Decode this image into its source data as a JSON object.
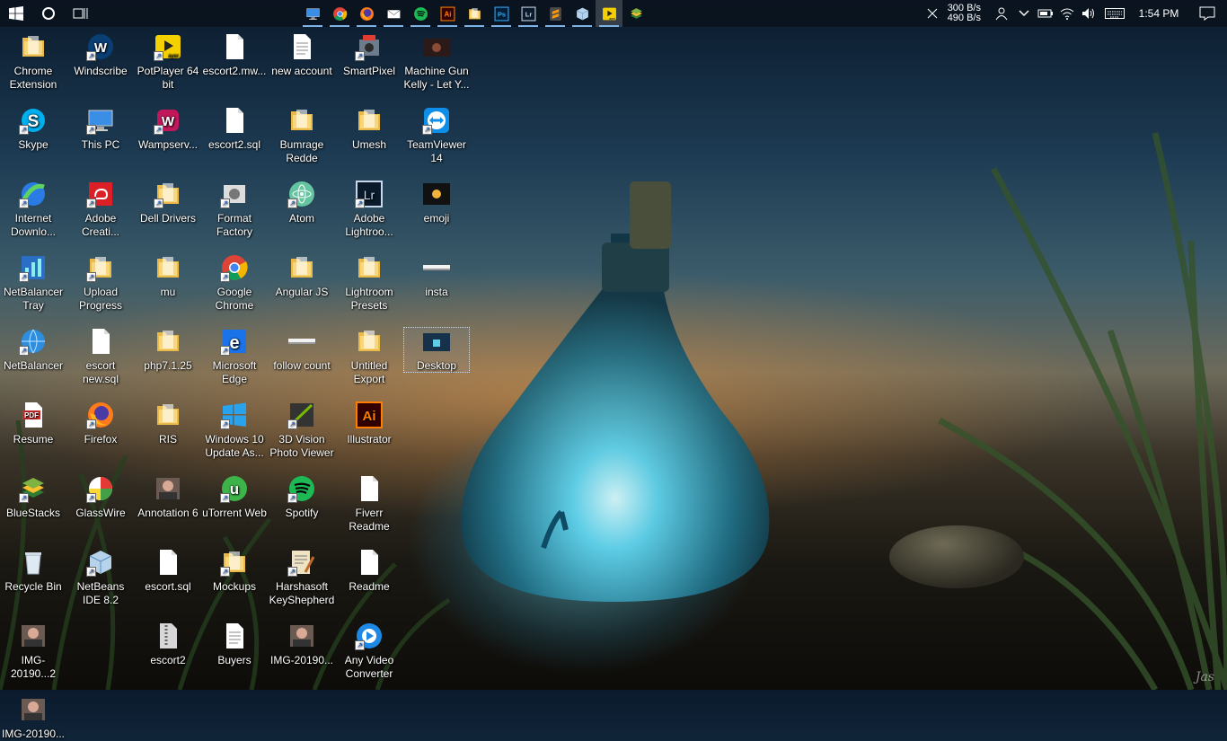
{
  "taskbar": {
    "network_up": "300 B/s",
    "network_down": "490 B/s",
    "clock": "1:54 PM",
    "apps": [
      {
        "name": "this-pc",
        "icon": "monitor-icon",
        "color": "#3a8ee6",
        "text": ""
      },
      {
        "name": "chrome",
        "icon": "chrome-icon",
        "color": "#e8453c",
        "text": ""
      },
      {
        "name": "firefox",
        "icon": "firefox-icon",
        "color": "#ff7a1a",
        "text": ""
      },
      {
        "name": "mail",
        "icon": "mail-icon",
        "color": "#ffffff",
        "text": ""
      },
      {
        "name": "spotify",
        "icon": "spotify-icon",
        "color": "#1db954",
        "text": ""
      },
      {
        "name": "illustrator",
        "icon": "illustrator-icon",
        "color": "#ff7c00",
        "text": "Ai"
      },
      {
        "name": "file-explorer",
        "icon": "folder-icon",
        "color": "#f2c04d",
        "text": ""
      },
      {
        "name": "photoshop",
        "icon": "photoshop-icon",
        "color": "#31a8ff",
        "text": "Ps"
      },
      {
        "name": "lightroom",
        "icon": "lightroom-icon",
        "color": "#9fc3e8",
        "text": "Lr"
      },
      {
        "name": "sublime",
        "icon": "sublime-icon",
        "color": "#ff9800",
        "text": ""
      },
      {
        "name": "netbeans",
        "icon": "cube-icon",
        "color": "#cfe3f5",
        "text": ""
      },
      {
        "name": "potplayer",
        "icon": "potplayer-icon",
        "color": "#f5d000",
        "text": ""
      },
      {
        "name": "bluestacks",
        "icon": "bluestacks-icon",
        "color": "#8bc34a",
        "text": ""
      }
    ]
  },
  "desktop": {
    "icons": [
      {
        "label": "Chrome Extension",
        "icon": "folder-icon",
        "shortcut": false
      },
      {
        "label": "Skype",
        "icon": "skype-icon",
        "shortcut": true
      },
      {
        "label": "Internet Downlo...",
        "icon": "idm-icon",
        "shortcut": true
      },
      {
        "label": "NetBalancer Tray",
        "icon": "netbalancer-icon",
        "shortcut": true
      },
      {
        "label": "NetBalancer",
        "icon": "globe-icon",
        "shortcut": true
      },
      {
        "label": "Resume",
        "icon": "pdf-icon",
        "shortcut": false
      },
      {
        "label": "BlueStacks",
        "icon": "bluestacks-icon",
        "shortcut": true
      },
      {
        "label": "Recycle Bin",
        "icon": "recycle-bin-icon",
        "shortcut": false
      },
      {
        "label": "IMG-20190...2",
        "icon": "photo-icon",
        "shortcut": false
      },
      {
        "label": "IMG-20190...",
        "icon": "photo-icon",
        "shortcut": false
      },
      {
        "label": "Windscribe",
        "icon": "windscribe-icon",
        "shortcut": true
      },
      {
        "label": "This PC",
        "icon": "monitor-icon",
        "shortcut": true
      },
      {
        "label": "Adobe Creati...",
        "icon": "creative-cloud-icon",
        "shortcut": true
      },
      {
        "label": "Upload Progress",
        "icon": "folder-icon",
        "shortcut": true
      },
      {
        "label": "escort new.sql",
        "icon": "file-icon",
        "shortcut": false
      },
      {
        "label": "Firefox",
        "icon": "firefox-icon",
        "shortcut": true
      },
      {
        "label": "GlassWire",
        "icon": "glasswire-icon",
        "shortcut": true
      },
      {
        "label": "NetBeans IDE 8.2",
        "icon": "cube-icon",
        "shortcut": true
      },
      {
        "label": "PotPlayer 64 bit",
        "icon": "potplayer-icon",
        "shortcut": true
      },
      {
        "label": "Wampserv...",
        "icon": "wamp-icon",
        "shortcut": true
      },
      {
        "label": "Dell Drivers",
        "icon": "folder-icon",
        "shortcut": true
      },
      {
        "label": "mu",
        "icon": "folder-icon",
        "shortcut": false
      },
      {
        "label": "php7.1.25",
        "icon": "folder-icon",
        "shortcut": false
      },
      {
        "label": "RIS",
        "icon": "folder-icon",
        "shortcut": false
      },
      {
        "label": "Annotation 6",
        "icon": "photo-icon",
        "shortcut": false
      },
      {
        "label": "escort.sql",
        "icon": "file-icon",
        "shortcut": false
      },
      {
        "label": "escort2",
        "icon": "archive-icon",
        "shortcut": false
      },
      {
        "label": "escort2.mw...",
        "icon": "file-icon",
        "shortcut": false
      },
      {
        "label": "escort2.sql",
        "icon": "file-icon",
        "shortcut": false
      },
      {
        "label": "Format Factory",
        "icon": "format-factory-icon",
        "shortcut": true
      },
      {
        "label": "Google Chrome",
        "icon": "chrome-icon",
        "shortcut": true
      },
      {
        "label": "Microsoft Edge",
        "icon": "edge-icon",
        "shortcut": true
      },
      {
        "label": "Windows 10 Update As...",
        "icon": "windows-icon",
        "shortcut": true
      },
      {
        "label": "uTorrent Web",
        "icon": "utorrent-icon",
        "shortcut": true
      },
      {
        "label": "Mockups",
        "icon": "folder-icon",
        "shortcut": true
      },
      {
        "label": "Buyers",
        "icon": "text-file-icon",
        "shortcut": false
      },
      {
        "label": "new account",
        "icon": "text-file-icon",
        "shortcut": false
      },
      {
        "label": "Bumrage Redde",
        "icon": "folder-icon",
        "shortcut": false
      },
      {
        "label": "Atom",
        "icon": "atom-icon",
        "shortcut": true
      },
      {
        "label": "Angular JS",
        "icon": "folder-icon",
        "shortcut": false
      },
      {
        "label": "follow count",
        "icon": "strip-icon",
        "shortcut": false
      },
      {
        "label": "3D Vision Photo Viewer",
        "icon": "3d-vision-icon",
        "shortcut": true
      },
      {
        "label": "Spotify",
        "icon": "spotify-icon",
        "shortcut": true
      },
      {
        "label": "Harshasoft KeyShepherd",
        "icon": "keyshepherd-icon",
        "shortcut": true
      },
      {
        "label": "IMG-20190...",
        "icon": "photo-icon",
        "shortcut": false
      },
      {
        "label": "SmartPixel",
        "icon": "smartpixel-icon",
        "shortcut": true
      },
      {
        "label": "Umesh",
        "icon": "folder-icon",
        "shortcut": false
      },
      {
        "label": "Adobe Lightroo...",
        "icon": "lightroom-icon",
        "shortcut": true
      },
      {
        "label": "Lightroom Presets",
        "icon": "folder-icon",
        "shortcut": false
      },
      {
        "label": "Untitled Export",
        "icon": "folder-icon",
        "shortcut": false
      },
      {
        "label": "Illustrator",
        "icon": "illustrator-icon",
        "shortcut": false
      },
      {
        "label": "Fiverr Readme",
        "icon": "file-icon",
        "shortcut": false
      },
      {
        "label": "Readme",
        "icon": "file-icon",
        "shortcut": false
      },
      {
        "label": "Any Video Converter",
        "icon": "video-converter-icon",
        "shortcut": true
      },
      {
        "label": "Machine Gun Kelly - Let Y...",
        "icon": "video-thumb-icon",
        "shortcut": false
      },
      {
        "label": "TeamViewer 14",
        "icon": "teamviewer-icon",
        "shortcut": true
      },
      {
        "label": "emoji",
        "icon": "emoji-thumb-icon",
        "shortcut": false
      },
      {
        "label": "insta",
        "icon": "strip-icon",
        "shortcut": false
      },
      {
        "label": "Desktop",
        "icon": "desktop-thumb-icon",
        "shortcut": false
      }
    ]
  },
  "watermark": "Jas"
}
